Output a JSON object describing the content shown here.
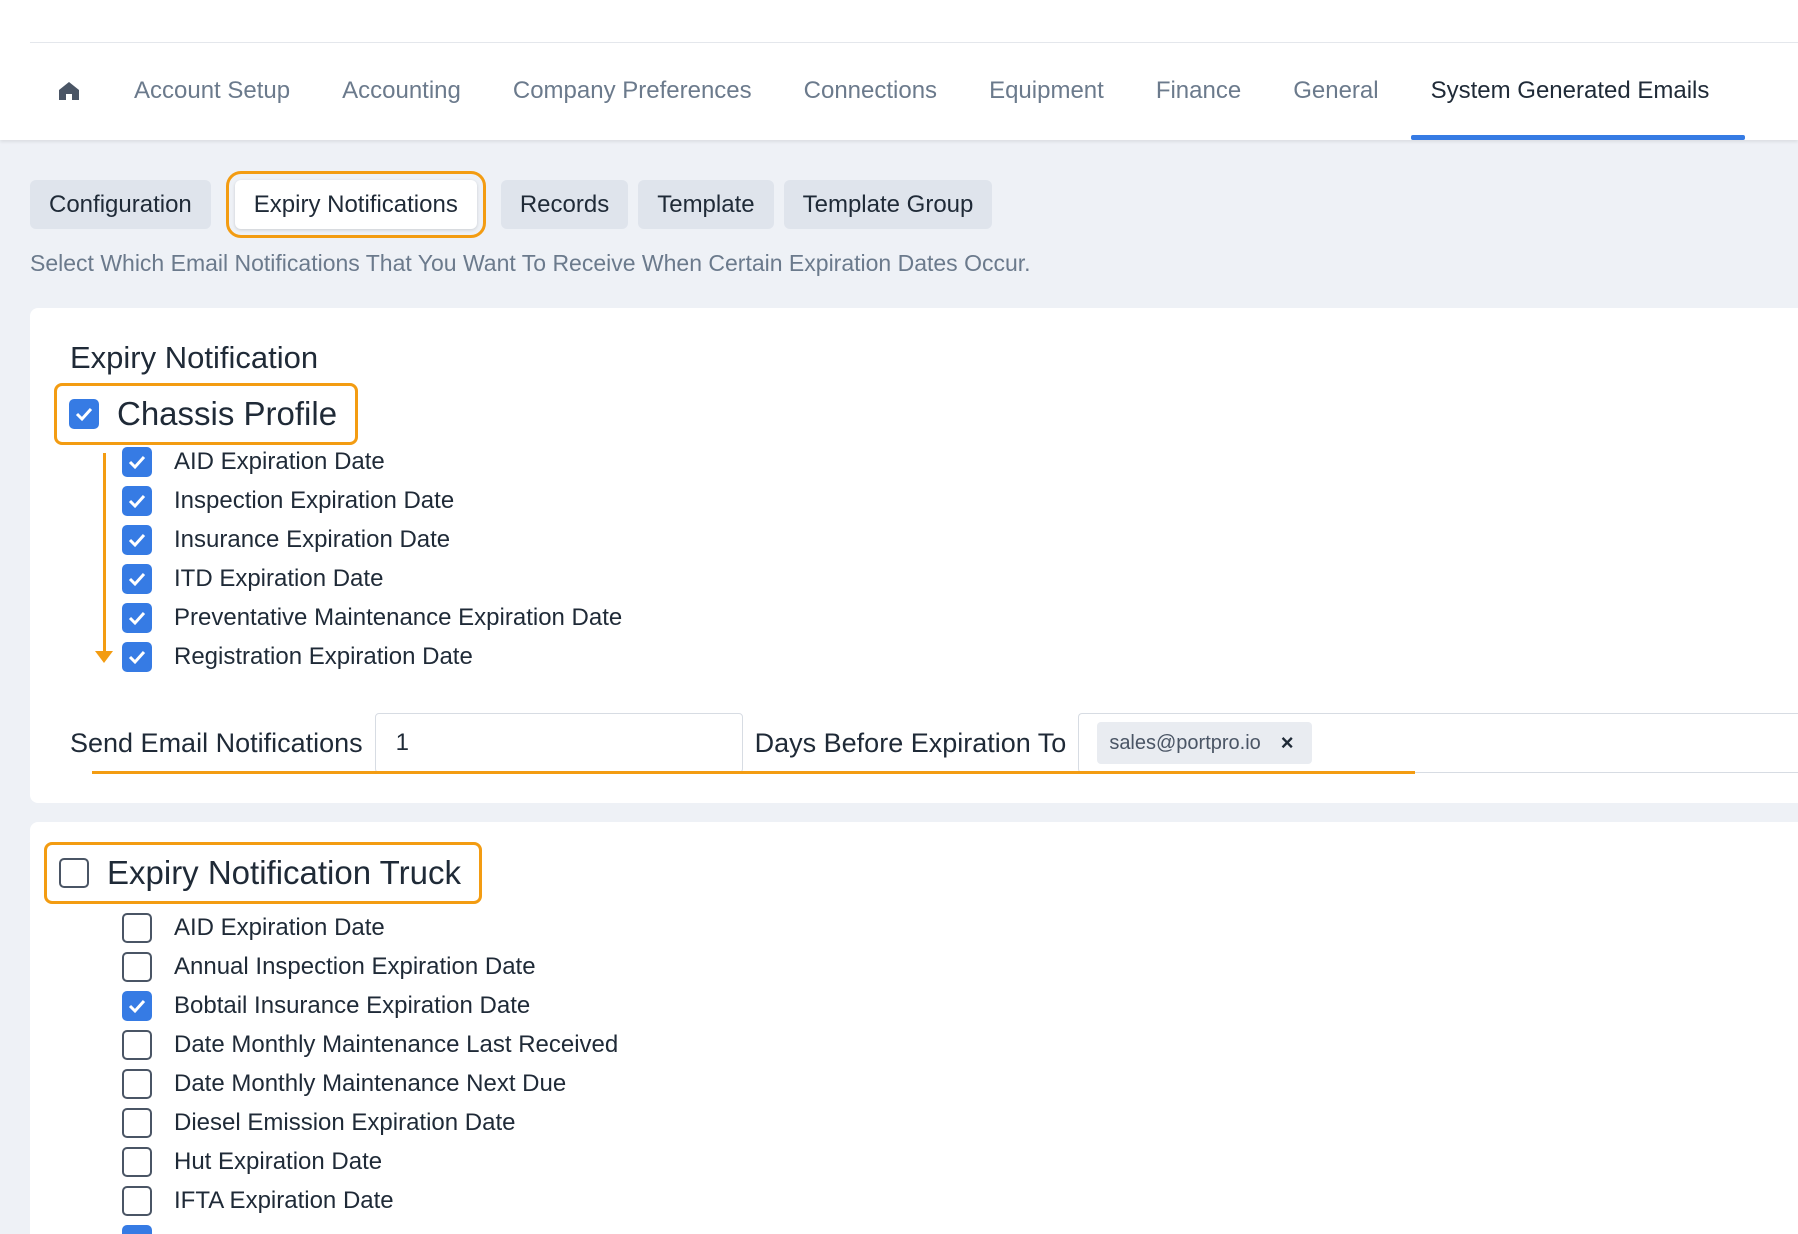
{
  "nav": {
    "items": [
      {
        "label": "Account Setup"
      },
      {
        "label": "Accounting"
      },
      {
        "label": "Company Preferences"
      },
      {
        "label": "Connections"
      },
      {
        "label": "Equipment"
      },
      {
        "label": "Finance"
      },
      {
        "label": "General"
      },
      {
        "label": "System Generated Emails",
        "active": true
      }
    ]
  },
  "subtabs": [
    {
      "label": "Configuration"
    },
    {
      "label": "Expiry Notifications",
      "active": true
    },
    {
      "label": "Records"
    },
    {
      "label": "Template"
    },
    {
      "label": "Template Group"
    }
  ],
  "helptext": "Select Which Email Notifications That You Want To Receive When Certain Expiration Dates Occur.",
  "section1": {
    "title": "Expiry Notification",
    "group_label": "Chassis Profile",
    "group_checked": true,
    "items": [
      {
        "label": "AID Expiration Date",
        "checked": true
      },
      {
        "label": "Inspection Expiration Date",
        "checked": true
      },
      {
        "label": "Insurance Expiration Date",
        "checked": true
      },
      {
        "label": "ITD Expiration Date",
        "checked": true
      },
      {
        "label": "Preventative Maintenance Expiration Date",
        "checked": true
      },
      {
        "label": "Registration Expiration Date",
        "checked": true
      }
    ],
    "send_label": "Send Email Notifications",
    "days_value": "1",
    "days_label": "Days Before Expiration To",
    "email_chip": "sales@portpro.io",
    "chip_remove": "×"
  },
  "section2": {
    "group_label": "Expiry Notification Truck",
    "group_checked": false,
    "items": [
      {
        "label": "AID Expiration Date",
        "checked": false
      },
      {
        "label": "Annual Inspection Expiration Date",
        "checked": false
      },
      {
        "label": "Bobtail Insurance Expiration Date",
        "checked": true
      },
      {
        "label": "Date Monthly Maintenance Last Received",
        "checked": false
      },
      {
        "label": "Date Monthly Maintenance Next Due",
        "checked": false
      },
      {
        "label": "Diesel Emission Expiration Date",
        "checked": false
      },
      {
        "label": "Hut Expiration Date",
        "checked": false
      },
      {
        "label": "IFTA Expiration Date",
        "checked": false
      },
      {
        "label": "",
        "checked": true
      }
    ]
  },
  "colors": {
    "accent": "#367be4",
    "highlight": "#f39c12"
  }
}
